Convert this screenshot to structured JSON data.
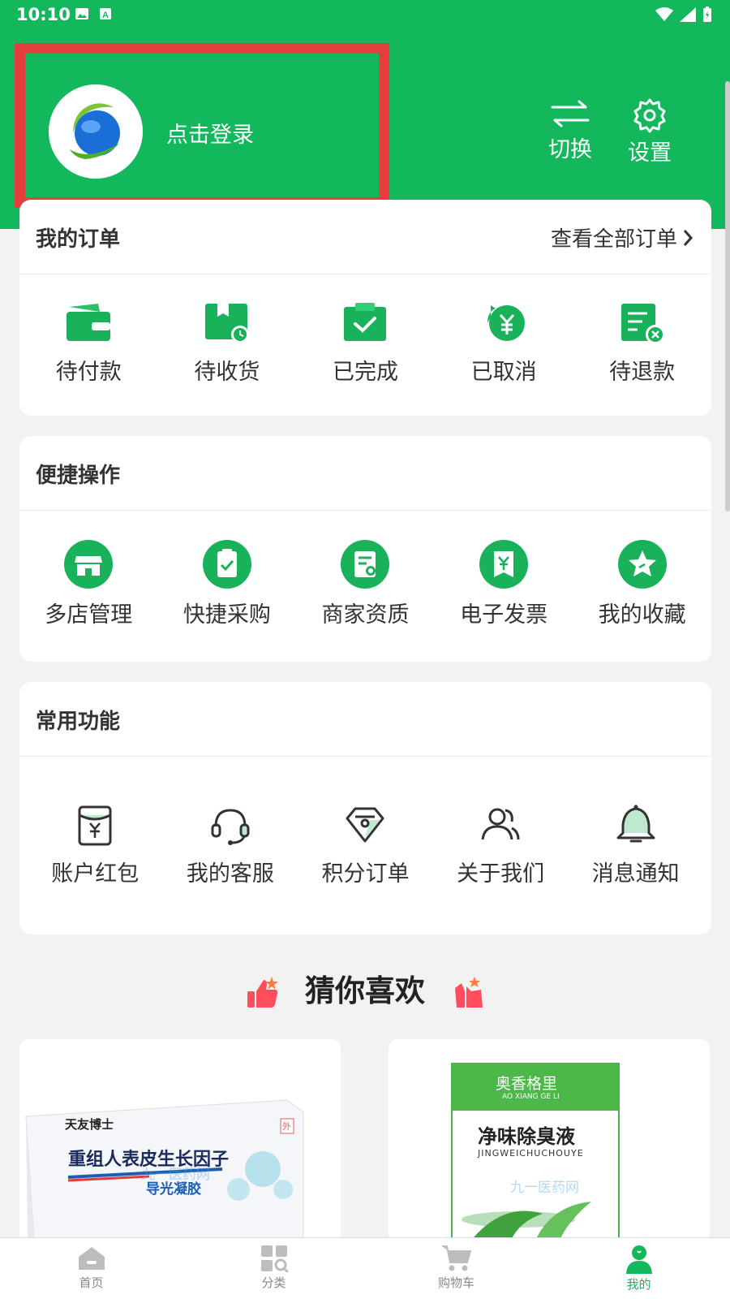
{
  "status_bar": {
    "time": "10:10"
  },
  "profile": {
    "login_label": "点击登录"
  },
  "header_actions": {
    "switch_label": "切换",
    "settings_label": "设置"
  },
  "orders": {
    "title": "我的订单",
    "view_all": "查看全部订单",
    "items": [
      {
        "label": "待付款",
        "icon": "wallet-icon"
      },
      {
        "label": "待收货",
        "icon": "delivery-box-icon"
      },
      {
        "label": "已完成",
        "icon": "completed-check-icon"
      },
      {
        "label": "已取消",
        "icon": "refund-yuan-icon"
      },
      {
        "label": "待退款",
        "icon": "refund-pending-icon"
      }
    ]
  },
  "quick_actions": {
    "title": "便捷操作",
    "items": [
      {
        "label": "多店管理",
        "icon": "store-icon"
      },
      {
        "label": "快捷采购",
        "icon": "clipboard-check-icon"
      },
      {
        "label": "商家资质",
        "icon": "certificate-icon"
      },
      {
        "label": "电子发票",
        "icon": "invoice-icon"
      },
      {
        "label": "我的收藏",
        "icon": "star-icon"
      }
    ]
  },
  "common_functions": {
    "title": "常用功能",
    "items": [
      {
        "label": "账户红包",
        "icon": "red-packet-icon"
      },
      {
        "label": "我的客服",
        "icon": "headset-icon"
      },
      {
        "label": "积分订单",
        "icon": "points-tag-icon"
      },
      {
        "label": "关于我们",
        "icon": "users-icon"
      },
      {
        "label": "消息通知",
        "icon": "bell-icon"
      }
    ]
  },
  "recommend": {
    "title": "猜你喜欢"
  },
  "products": [
    {
      "brand": "天友博士",
      "name": "重组人表皮生长因子",
      "subtitle": "导光凝胶",
      "badge": "外"
    },
    {
      "brand": "奥香格里",
      "brand_pinyin": "AO XIANG GE LI",
      "name": "净味除臭液",
      "pinyin": "JINGWEICHUCHOUYE"
    }
  ],
  "watermark": "九一医药网",
  "tabbar": {
    "tabs": [
      {
        "label": "首页",
        "icon": "home-icon",
        "active": false
      },
      {
        "label": "分类",
        "icon": "category-icon",
        "active": false
      },
      {
        "label": "购物车",
        "icon": "cart-icon",
        "active": false
      },
      {
        "label": "我的",
        "icon": "profile-icon",
        "active": true
      }
    ]
  },
  "colors": {
    "brand_green": "#13b85c",
    "highlight_red": "#e53e3e"
  }
}
